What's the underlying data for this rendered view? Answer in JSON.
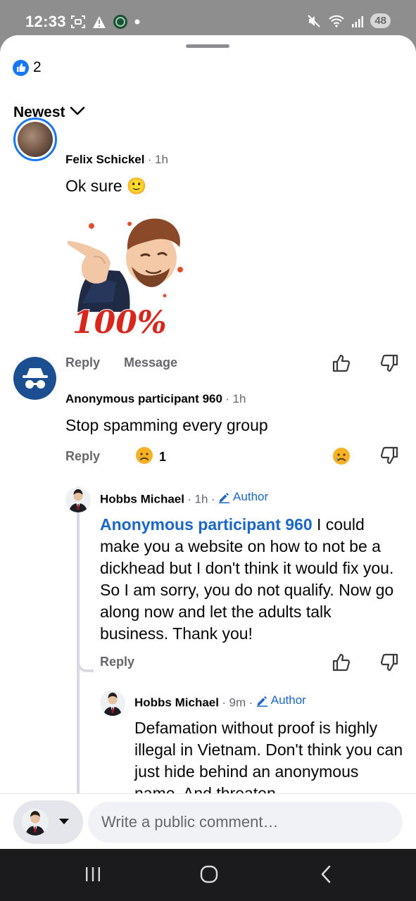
{
  "status_bar": {
    "time": "12:33",
    "battery": "48"
  },
  "post_reactions": {
    "like_count": "2"
  },
  "sort": {
    "label": "Newest"
  },
  "comments": [
    {
      "author": "Felix Schickel",
      "time": "1h",
      "text": "Ok sure",
      "emoji": "🙂",
      "sticker_text": "100%",
      "actions": {
        "reply": "Reply",
        "message": "Message"
      }
    },
    {
      "author": "Anonymous participant 960",
      "time": "1h",
      "text": "Stop spamming every group",
      "actions": {
        "reply": "Reply"
      },
      "reaction_count": "1",
      "replies": [
        {
          "author": "Hobbs Michael",
          "time": "1h",
          "badge": "Author",
          "mention": "Anonymous participant 960",
          "text": "I could make you a website on how to not be a dickhead but I don't think it would fix you. So I am sorry, you do not qualify. Now go along now and let the adults talk business. Thank you!",
          "actions": {
            "reply": "Reply"
          }
        },
        {
          "author": "Hobbs Michael",
          "time": "9m",
          "badge": "Author",
          "text": "Defamation without proof is highly illegal in Vietnam. Don't think you can just hide behind an anonymous name. And threaten"
        }
      ]
    }
  ],
  "composer": {
    "placeholder": "Write a public comment…"
  },
  "colors": {
    "accent": "#1877f2",
    "link": "#1b66c9",
    "anon_avatar": "#1b4f91",
    "sticker_red": "#d9261c"
  }
}
